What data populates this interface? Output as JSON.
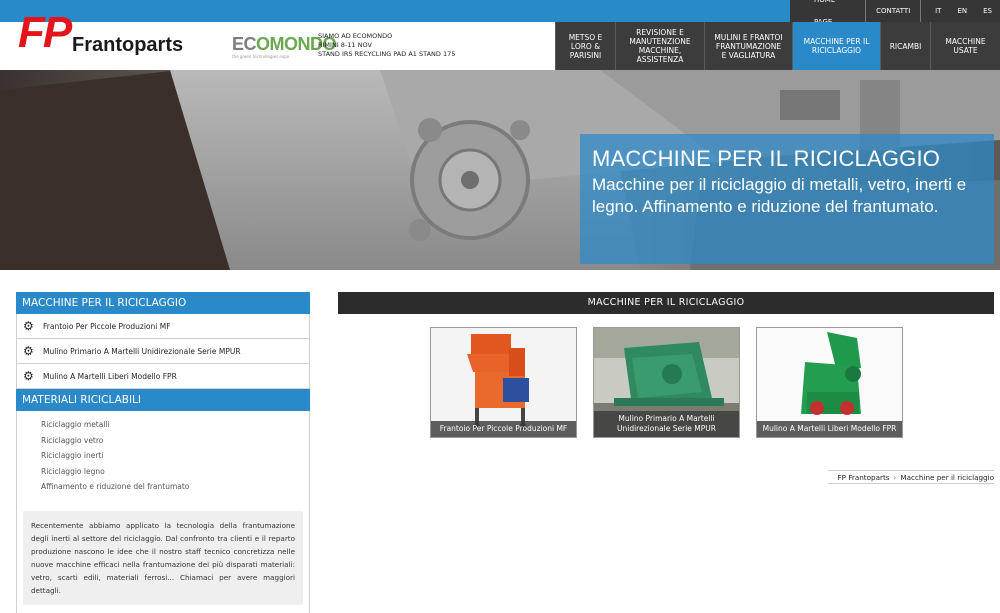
{
  "toplinks": {
    "home": "HOME PAGE",
    "contacts": "CONTATTI",
    "langs": [
      "IT",
      "EN",
      "ES"
    ]
  },
  "logo": {
    "mark": "FP",
    "word": "Frantoparts"
  },
  "ecomondo": {
    "brand_a": "EC",
    "brand_b": "OMONDO",
    "tag": "the green technologies expo",
    "info": [
      "SIAMO AD ECOMONDO",
      "RIMINI 8-11 NOV",
      "STAND IRS RECYCLING PAD A1 STAND 175"
    ]
  },
  "nav": [
    {
      "lines": [
        "METSO E",
        "LORO &",
        "PARISINI"
      ],
      "active": false
    },
    {
      "lines": [
        "REVISIONE E",
        "MANUTENZIONE",
        "MACCHINE,",
        "ASSISTENZA"
      ],
      "active": false
    },
    {
      "lines": [
        "MULINI E FRANTOI",
        "FRANTUMAZIONE",
        "E VAGLIATURA"
      ],
      "active": false
    },
    {
      "lines": [
        "MACCHINE PER IL",
        "RICICLAGGIO"
      ],
      "active": true
    },
    {
      "lines": [
        "RICAMBI"
      ],
      "active": false
    },
    {
      "lines": [
        "MACCHINE",
        "USATE"
      ],
      "active": false
    }
  ],
  "hero": {
    "title": "MACCHINE PER IL RICICLAGGIO",
    "subtitle": "Macchine per il riciclaggio di metalli, vetro, inerti e legno. Affinamento e riduzione del frantumato."
  },
  "sidebar": {
    "head1": "MACCHINE PER IL RICICLAGGIO",
    "products": [
      "Frantoio Per Piccole Produzioni MF",
      "Mulino Primario A Martelli Unidirezionale Serie MPUR",
      "Mulino A Martelli Liberi Modello FPR"
    ],
    "head2": "MATERIALI RICICLABILI",
    "materials": [
      "Riciclaggio metalli",
      "Riciclaggio vetro",
      "Riciclaggio inerti",
      "Riciclaggio legno",
      "Affinamento e riduzione del frantumato"
    ],
    "note": "Recentemente abbiamo applicato la tecnologia della frantumazione degli inerti al settore del riciclaggio. Dal confronto tra clienti e il reparto produzione nascono le idee che il nostro staff tecnico concretizza nelle nuove macchine efficaci nella frantumazione dei più disparati materiali: vetro, scarti edili, materiali ferrosi... Chiamaci per avere maggiori dettagli."
  },
  "main": {
    "section_title": "MACCHINE PER IL RICICLAGGIO",
    "cards": [
      "Frantoio Per Piccole Produzioni MF",
      "Mulino Primario A Martelli Unidirezionale Serie MPUR",
      "Mulino A Martelli Liberi Modello FPR"
    ],
    "breadcrumb": [
      "FP Frantoparts",
      "Macchine per il riciclaggio"
    ]
  }
}
